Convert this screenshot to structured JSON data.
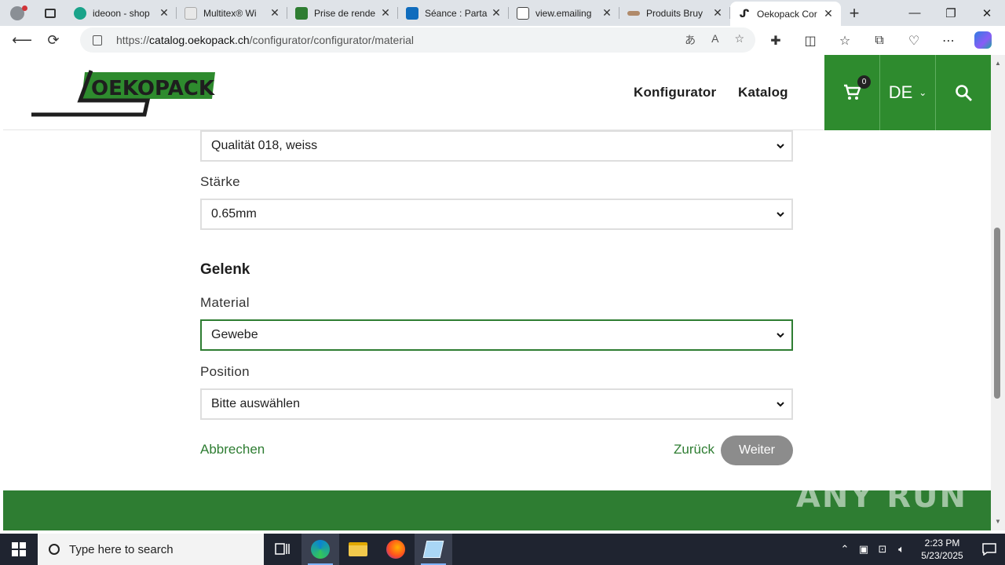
{
  "browser": {
    "tabs": [
      {
        "title": "ideoon - shop",
        "fav_color": "#1aa38a",
        "active": false
      },
      {
        "title": "Multitex® Wi",
        "fav_color": "#9aa3ad",
        "active": false
      },
      {
        "title": "Prise de rende",
        "fav_color": "#2e7d32",
        "active": false
      },
      {
        "title": "Séance : Parta",
        "fav_color": "#0f6cbd",
        "active": false
      },
      {
        "title": "view.emailing",
        "fav_color": "#666666",
        "active": false
      },
      {
        "title": "Produits Bruy",
        "fav_color": "#b08a6a",
        "active": false
      },
      {
        "title": "Oekopack Cor",
        "fav_color": "#222222",
        "active": true
      }
    ],
    "url_prefix": "https://",
    "url_domain": "catalog.oekopack.ch",
    "url_path": "/configurator/configurator/material"
  },
  "site": {
    "logo_text": "OEKOPACK",
    "nav": {
      "configurator": "Konfigurator",
      "catalog": "Katalog"
    },
    "cart_count": "0",
    "language": "DE",
    "brand_color": "#2e8b2e"
  },
  "form": {
    "quality_value": "Qualität 018, weiss",
    "thickness_label": "Stärke",
    "thickness_value": "0.65mm",
    "section_hinge": "Gelenk",
    "material_label": "Material",
    "material_value": "Gewebe",
    "position_label": "Position",
    "position_value": "Bitte auswählen",
    "cancel": "Abbrechen",
    "back": "Zurück",
    "next": "Weiter"
  },
  "watermark": "ANY RUN",
  "taskbar": {
    "search_placeholder": "Type here to search",
    "time": "2:23 PM",
    "date": "5/23/2025"
  }
}
